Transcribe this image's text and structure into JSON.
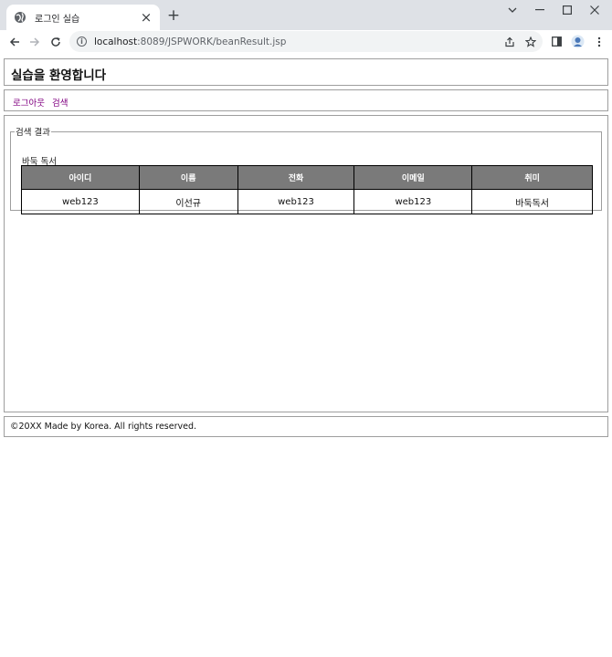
{
  "browser": {
    "tab_title": "로그인 실습",
    "url_host": "localhost",
    "url_path": ":8089/JSPWORK/beanResult.jsp"
  },
  "header": {
    "title": "실습을 환영합니다"
  },
  "nav": {
    "logout_label": "로그아웃",
    "search_label": "검색"
  },
  "result": {
    "legend": "검색 결과",
    "hobby_line": "바둑 독서",
    "columns": [
      "아이디",
      "이름",
      "전화",
      "이메일",
      "취미"
    ],
    "rows": [
      [
        "web123",
        "이선규",
        "web123",
        "web123",
        "바둑독서"
      ]
    ]
  },
  "footer": {
    "copyright": "©20XX Made by Korea. All rights reserved."
  }
}
